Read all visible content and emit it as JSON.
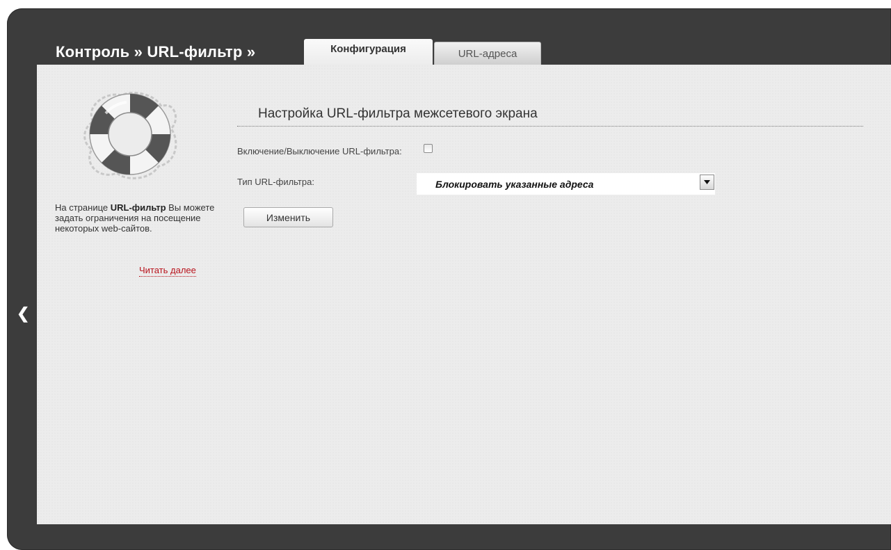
{
  "header": {
    "breadcrumb": "Контроль » URL-фильтр »",
    "tabs": [
      {
        "label": "Конфигурация",
        "active": true
      },
      {
        "label": "URL-адреса",
        "active": false
      }
    ]
  },
  "sidebar": {
    "icon": "lifebuoy-icon",
    "help_prefix": "На странице ",
    "help_bold": "URL-фильтр",
    "help_suffix": " Вы можете задать ограничения на посещение некоторых web-сайтов.",
    "read_more": "Читать далее",
    "collapse_icon": "chevron-left-icon"
  },
  "form": {
    "title": "Настройка URL-фильтра межсетевого экрана",
    "enable_label": "Включение/Выключение URL-фильтра:",
    "enable_checked": false,
    "type_label": "Тип URL-фильтра:",
    "type_value": "Блокировать указанные адреса",
    "submit_label": "Изменить"
  },
  "colors": {
    "frame": "#3c3c3c",
    "panel": "#ececec",
    "link": "#b8121b"
  }
}
